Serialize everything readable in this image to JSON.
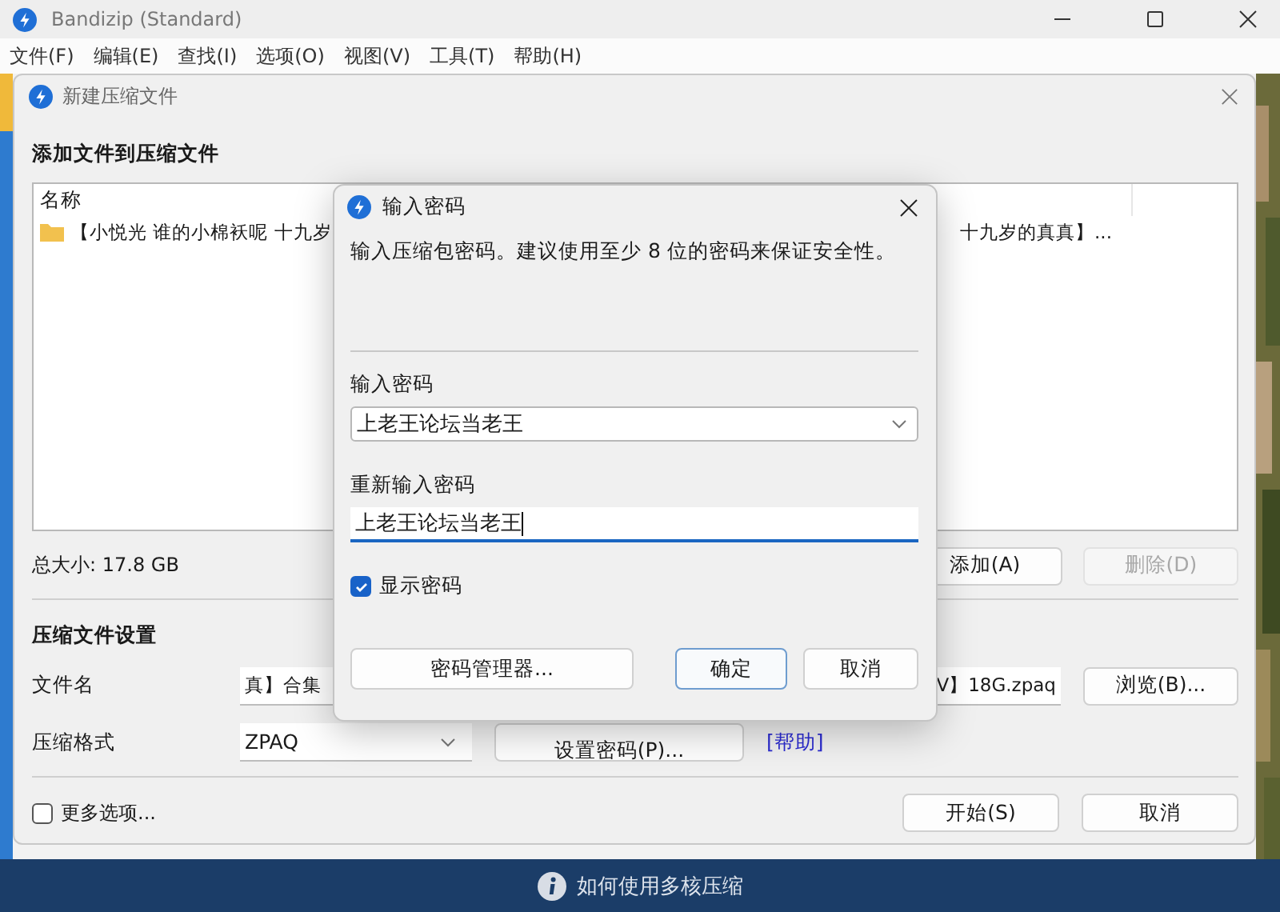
{
  "window": {
    "title": "Bandizip (Standard)"
  },
  "menu": [
    "文件(F)",
    "编辑(E)",
    "查找(I)",
    "选项(O)",
    "视图(V)",
    "工具(T)",
    "帮助(H)"
  ],
  "compress_window": {
    "title": "新建压缩文件",
    "add_heading": "添加文件到压缩文件",
    "list_header": "名称",
    "file_row": {
      "start": "【小悦光 谁的小棉袄呢 十九岁",
      "end": "十九岁的真真】..."
    },
    "total_size": "总大小: 17.8 GB",
    "add_button": {
      "label": "添加(A)",
      "disabled": false
    },
    "delete_button": {
      "label": "删除(D)",
      "disabled": true
    },
    "settings_heading": "压缩文件设置",
    "filename_label": "文件名",
    "filename_start": "真】合集",
    "filename_end": "V】18G.zpaq",
    "browse_button": "浏览(B)...",
    "format_label": "压缩格式",
    "format": "ZPAQ",
    "password_button": "设置密码(P)...",
    "help_link": "[帮助]",
    "more_options": {
      "label": "更多选项...",
      "checked": false
    },
    "start_button": "开始(S)",
    "cancel_button": "取消"
  },
  "dialog": {
    "title": "输入密码",
    "description": "输入压缩包密码。建议使用至少 8 位的密码来保证安全性。",
    "password_label": "输入密码",
    "password": "上老王论坛当老王",
    "repeat_label": "重新输入密码",
    "repeat": "上老王论坛当老王",
    "show_password": {
      "label": "显示密码",
      "checked": true
    },
    "manager_button": "密码管理器...",
    "ok_button": "确定",
    "cancel_button": "取消"
  },
  "tip": "如何使用多核压缩"
}
